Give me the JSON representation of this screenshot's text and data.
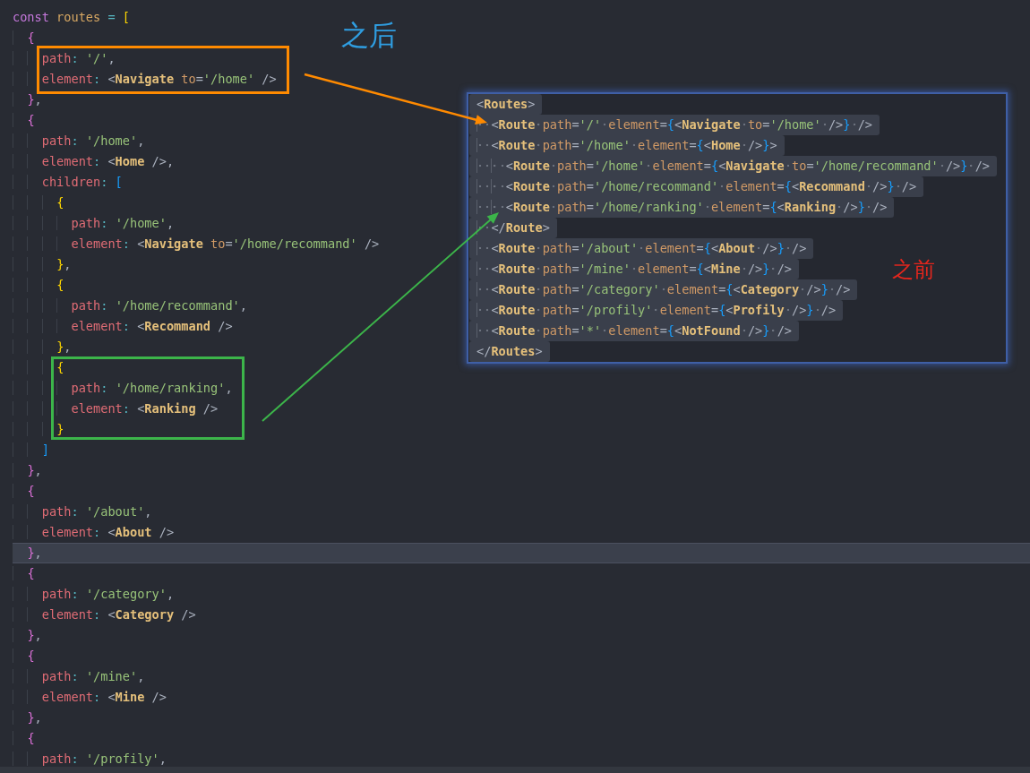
{
  "editor": {
    "lines": [
      {
        "current": false,
        "tokens": [
          {
            "text": "const ",
            "kind": "keyword"
          },
          {
            "text": "routes ",
            "kind": "variable"
          },
          {
            "text": "= ",
            "kind": "operator"
          },
          {
            "text": "[",
            "kind": "bracket1"
          }
        ]
      },
      {
        "current": false,
        "tokens": [
          {
            "text": "  {",
            "kind": "bracket2"
          }
        ]
      },
      {
        "current": false,
        "tokens": [
          {
            "text": "    path",
            "kind": "key"
          },
          {
            "text": ": ",
            "kind": "colon"
          },
          {
            "text": "'/'",
            "kind": "string"
          },
          {
            "text": ",",
            "kind": "punct"
          }
        ]
      },
      {
        "current": false,
        "tokens": [
          {
            "text": "    element",
            "kind": "key"
          },
          {
            "text": ": ",
            "kind": "colon"
          },
          {
            "text": "<",
            "kind": "punct"
          },
          {
            "text": "Navigate ",
            "kind": "tag"
          },
          {
            "text": "to",
            "kind": "attr"
          },
          {
            "text": "=",
            "kind": "punct"
          },
          {
            "text": "'/home' ",
            "kind": "string"
          },
          {
            "text": "/>",
            "kind": "punct"
          }
        ]
      },
      {
        "current": false,
        "tokens": [
          {
            "text": "  }",
            "kind": "bracket2"
          },
          {
            "text": ",",
            "kind": "punct"
          }
        ]
      },
      {
        "current": false,
        "tokens": [
          {
            "text": "  {",
            "kind": "bracket2"
          }
        ]
      },
      {
        "current": false,
        "tokens": [
          {
            "text": "    path",
            "kind": "key"
          },
          {
            "text": ": ",
            "kind": "colon"
          },
          {
            "text": "'/home'",
            "kind": "string"
          },
          {
            "text": ",",
            "kind": "punct"
          }
        ]
      },
      {
        "current": false,
        "tokens": [
          {
            "text": "    element",
            "kind": "key"
          },
          {
            "text": ": ",
            "kind": "colon"
          },
          {
            "text": "<",
            "kind": "punct"
          },
          {
            "text": "Home ",
            "kind": "tag"
          },
          {
            "text": "/>,",
            "kind": "punct"
          }
        ]
      },
      {
        "current": false,
        "tokens": [
          {
            "text": "    children",
            "kind": "key"
          },
          {
            "text": ": ",
            "kind": "colon"
          },
          {
            "text": "[",
            "kind": "bracket3"
          }
        ]
      },
      {
        "current": false,
        "tokens": [
          {
            "text": "      {",
            "kind": "bracket1"
          }
        ]
      },
      {
        "current": false,
        "tokens": [
          {
            "text": "        path",
            "kind": "key"
          },
          {
            "text": ": ",
            "kind": "colon"
          },
          {
            "text": "'/home'",
            "kind": "string"
          },
          {
            "text": ",",
            "kind": "punct"
          }
        ]
      },
      {
        "current": false,
        "tokens": [
          {
            "text": "        element",
            "kind": "key"
          },
          {
            "text": ": ",
            "kind": "colon"
          },
          {
            "text": "<",
            "kind": "punct"
          },
          {
            "text": "Navigate ",
            "kind": "tag"
          },
          {
            "text": "to",
            "kind": "attr"
          },
          {
            "text": "=",
            "kind": "punct"
          },
          {
            "text": "'/home/recommand' ",
            "kind": "string"
          },
          {
            "text": "/>",
            "kind": "punct"
          }
        ]
      },
      {
        "current": false,
        "tokens": [
          {
            "text": "      }",
            "kind": "bracket1"
          },
          {
            "text": ",",
            "kind": "punct"
          }
        ]
      },
      {
        "current": false,
        "tokens": [
          {
            "text": "      {",
            "kind": "bracket1"
          }
        ]
      },
      {
        "current": false,
        "tokens": [
          {
            "text": "        path",
            "kind": "key"
          },
          {
            "text": ": ",
            "kind": "colon"
          },
          {
            "text": "'/home/recommand'",
            "kind": "string"
          },
          {
            "text": ",",
            "kind": "punct"
          }
        ]
      },
      {
        "current": false,
        "tokens": [
          {
            "text": "        element",
            "kind": "key"
          },
          {
            "text": ": ",
            "kind": "colon"
          },
          {
            "text": "<",
            "kind": "punct"
          },
          {
            "text": "Recommand ",
            "kind": "tag"
          },
          {
            "text": "/>",
            "kind": "punct"
          }
        ]
      },
      {
        "current": false,
        "tokens": [
          {
            "text": "      }",
            "kind": "bracket1"
          },
          {
            "text": ",",
            "kind": "punct"
          }
        ]
      },
      {
        "current": false,
        "tokens": [
          {
            "text": "      {",
            "kind": "bracket1"
          }
        ]
      },
      {
        "current": false,
        "tokens": [
          {
            "text": "        path",
            "kind": "key"
          },
          {
            "text": ": ",
            "kind": "colon"
          },
          {
            "text": "'/home/ranking'",
            "kind": "string"
          },
          {
            "text": ",",
            "kind": "punct"
          }
        ]
      },
      {
        "current": false,
        "tokens": [
          {
            "text": "        element",
            "kind": "key"
          },
          {
            "text": ": ",
            "kind": "colon"
          },
          {
            "text": "<",
            "kind": "punct"
          },
          {
            "text": "Ranking ",
            "kind": "tag"
          },
          {
            "text": "/>",
            "kind": "punct"
          }
        ]
      },
      {
        "current": false,
        "tokens": [
          {
            "text": "      }",
            "kind": "bracket1"
          }
        ]
      },
      {
        "current": false,
        "tokens": [
          {
            "text": "    ]",
            "kind": "bracket3"
          }
        ]
      },
      {
        "current": false,
        "tokens": [
          {
            "text": "  }",
            "kind": "bracket2"
          },
          {
            "text": ",",
            "kind": "punct"
          }
        ]
      },
      {
        "current": false,
        "tokens": [
          {
            "text": "  {",
            "kind": "bracket2"
          }
        ]
      },
      {
        "current": false,
        "tokens": [
          {
            "text": "    path",
            "kind": "key"
          },
          {
            "text": ": ",
            "kind": "colon"
          },
          {
            "text": "'/about'",
            "kind": "string"
          },
          {
            "text": ",",
            "kind": "punct"
          }
        ]
      },
      {
        "current": false,
        "tokens": [
          {
            "text": "    element",
            "kind": "key"
          },
          {
            "text": ": ",
            "kind": "colon"
          },
          {
            "text": "<",
            "kind": "punct"
          },
          {
            "text": "About ",
            "kind": "tag"
          },
          {
            "text": "/>",
            "kind": "punct"
          }
        ]
      },
      {
        "current": true,
        "tokens": [
          {
            "text": "  }",
            "kind": "bracket2"
          },
          {
            "text": ",",
            "kind": "punct"
          }
        ]
      },
      {
        "current": false,
        "tokens": [
          {
            "text": "  {",
            "kind": "bracket2"
          }
        ]
      },
      {
        "current": false,
        "tokens": [
          {
            "text": "    path",
            "kind": "key"
          },
          {
            "text": ": ",
            "kind": "colon"
          },
          {
            "text": "'/category'",
            "kind": "string"
          },
          {
            "text": ",",
            "kind": "punct"
          }
        ]
      },
      {
        "current": false,
        "tokens": [
          {
            "text": "    element",
            "kind": "key"
          },
          {
            "text": ": ",
            "kind": "colon"
          },
          {
            "text": "<",
            "kind": "punct"
          },
          {
            "text": "Category ",
            "kind": "tag"
          },
          {
            "text": "/>",
            "kind": "punct"
          }
        ]
      },
      {
        "current": false,
        "tokens": [
          {
            "text": "  }",
            "kind": "bracket2"
          },
          {
            "text": ",",
            "kind": "punct"
          }
        ]
      },
      {
        "current": false,
        "tokens": [
          {
            "text": "  {",
            "kind": "bracket2"
          }
        ]
      },
      {
        "current": false,
        "tokens": [
          {
            "text": "    path",
            "kind": "key"
          },
          {
            "text": ": ",
            "kind": "colon"
          },
          {
            "text": "'/mine'",
            "kind": "string"
          },
          {
            "text": ",",
            "kind": "punct"
          }
        ]
      },
      {
        "current": false,
        "tokens": [
          {
            "text": "    element",
            "kind": "key"
          },
          {
            "text": ": ",
            "kind": "colon"
          },
          {
            "text": "<",
            "kind": "punct"
          },
          {
            "text": "Mine ",
            "kind": "tag"
          },
          {
            "text": "/>",
            "kind": "punct"
          }
        ]
      },
      {
        "current": false,
        "tokens": [
          {
            "text": "  }",
            "kind": "bracket2"
          },
          {
            "text": ",",
            "kind": "punct"
          }
        ]
      },
      {
        "current": false,
        "tokens": [
          {
            "text": "  {",
            "kind": "bracket2"
          }
        ]
      },
      {
        "current": false,
        "tokens": [
          {
            "text": "    path",
            "kind": "key"
          },
          {
            "text": ": ",
            "kind": "colon"
          },
          {
            "text": "'/profily'",
            "kind": "string"
          },
          {
            "text": ",",
            "kind": "punct"
          }
        ]
      }
    ]
  },
  "snippet": {
    "lines": [
      {
        "tokens": [
          {
            "text": "<",
            "kind": "punct"
          },
          {
            "text": "Routes",
            "kind": "tag"
          },
          {
            "text": ">",
            "kind": "punct"
          }
        ]
      },
      {
        "tokens": [
          {
            "text": "  <",
            "kind": "punct"
          },
          {
            "text": "Route ",
            "kind": "tag"
          },
          {
            "text": "path",
            "kind": "attr"
          },
          {
            "text": "=",
            "kind": "punct"
          },
          {
            "text": "'/' ",
            "kind": "string"
          },
          {
            "text": "element",
            "kind": "attr"
          },
          {
            "text": "=",
            "kind": "punct"
          },
          {
            "text": "{",
            "kind": "brace"
          },
          {
            "text": "<",
            "kind": "punct"
          },
          {
            "text": "Navigate ",
            "kind": "tag"
          },
          {
            "text": "to",
            "kind": "attr"
          },
          {
            "text": "=",
            "kind": "punct"
          },
          {
            "text": "'/home' ",
            "kind": "string"
          },
          {
            "text": "/>",
            "kind": "punct"
          },
          {
            "text": "} ",
            "kind": "brace"
          },
          {
            "text": "/>",
            "kind": "punct"
          }
        ]
      },
      {
        "tokens": [
          {
            "text": "  <",
            "kind": "punct"
          },
          {
            "text": "Route ",
            "kind": "tag"
          },
          {
            "text": "path",
            "kind": "attr"
          },
          {
            "text": "=",
            "kind": "punct"
          },
          {
            "text": "'/home' ",
            "kind": "string"
          },
          {
            "text": "element",
            "kind": "attr"
          },
          {
            "text": "=",
            "kind": "punct"
          },
          {
            "text": "{",
            "kind": "brace"
          },
          {
            "text": "<",
            "kind": "punct"
          },
          {
            "text": "Home ",
            "kind": "tag"
          },
          {
            "text": "/>",
            "kind": "punct"
          },
          {
            "text": "}",
            "kind": "brace"
          },
          {
            "text": ">",
            "kind": "punct"
          }
        ]
      },
      {
        "tokens": [
          {
            "text": "    <",
            "kind": "punct"
          },
          {
            "text": "Route ",
            "kind": "tag"
          },
          {
            "text": "path",
            "kind": "attr"
          },
          {
            "text": "=",
            "kind": "punct"
          },
          {
            "text": "'/home' ",
            "kind": "string"
          },
          {
            "text": "element",
            "kind": "attr"
          },
          {
            "text": "=",
            "kind": "punct"
          },
          {
            "text": "{",
            "kind": "brace"
          },
          {
            "text": "<",
            "kind": "punct"
          },
          {
            "text": "Navigate ",
            "kind": "tag"
          },
          {
            "text": "to",
            "kind": "attr"
          },
          {
            "text": "=",
            "kind": "punct"
          },
          {
            "text": "'/home/recommand' ",
            "kind": "string"
          },
          {
            "text": "/>",
            "kind": "punct"
          },
          {
            "text": "} ",
            "kind": "brace"
          },
          {
            "text": "/>",
            "kind": "punct"
          }
        ]
      },
      {
        "tokens": [
          {
            "text": "    <",
            "kind": "punct"
          },
          {
            "text": "Route ",
            "kind": "tag"
          },
          {
            "text": "path",
            "kind": "attr"
          },
          {
            "text": "=",
            "kind": "punct"
          },
          {
            "text": "'/home/recommand' ",
            "kind": "string"
          },
          {
            "text": "element",
            "kind": "attr"
          },
          {
            "text": "=",
            "kind": "punct"
          },
          {
            "text": "{",
            "kind": "brace"
          },
          {
            "text": "<",
            "kind": "punct"
          },
          {
            "text": "Recommand ",
            "kind": "tag"
          },
          {
            "text": "/>",
            "kind": "punct"
          },
          {
            "text": "} ",
            "kind": "brace"
          },
          {
            "text": "/>",
            "kind": "punct"
          }
        ]
      },
      {
        "tokens": [
          {
            "text": "    <",
            "kind": "punct"
          },
          {
            "text": "Route ",
            "kind": "tag"
          },
          {
            "text": "path",
            "kind": "attr"
          },
          {
            "text": "=",
            "kind": "punct"
          },
          {
            "text": "'/home/ranking' ",
            "kind": "string"
          },
          {
            "text": "element",
            "kind": "attr"
          },
          {
            "text": "=",
            "kind": "punct"
          },
          {
            "text": "{",
            "kind": "brace"
          },
          {
            "text": "<",
            "kind": "punct"
          },
          {
            "text": "Ranking ",
            "kind": "tag"
          },
          {
            "text": "/>",
            "kind": "punct"
          },
          {
            "text": "} ",
            "kind": "brace"
          },
          {
            "text": "/>",
            "kind": "punct"
          }
        ]
      },
      {
        "tokens": [
          {
            "text": "  </",
            "kind": "punct"
          },
          {
            "text": "Route",
            "kind": "tag"
          },
          {
            "text": ">",
            "kind": "punct"
          }
        ]
      },
      {
        "tokens": [
          {
            "text": "  <",
            "kind": "punct"
          },
          {
            "text": "Route ",
            "kind": "tag"
          },
          {
            "text": "path",
            "kind": "attr"
          },
          {
            "text": "=",
            "kind": "punct"
          },
          {
            "text": "'/about' ",
            "kind": "string"
          },
          {
            "text": "element",
            "kind": "attr"
          },
          {
            "text": "=",
            "kind": "punct"
          },
          {
            "text": "{",
            "kind": "brace"
          },
          {
            "text": "<",
            "kind": "punct"
          },
          {
            "text": "About ",
            "kind": "tag"
          },
          {
            "text": "/>",
            "kind": "punct"
          },
          {
            "text": "} ",
            "kind": "brace"
          },
          {
            "text": "/>",
            "kind": "punct"
          }
        ]
      },
      {
        "tokens": [
          {
            "text": "  <",
            "kind": "punct"
          },
          {
            "text": "Route ",
            "kind": "tag"
          },
          {
            "text": "path",
            "kind": "attr"
          },
          {
            "text": "=",
            "kind": "punct"
          },
          {
            "text": "'/mine' ",
            "kind": "string"
          },
          {
            "text": "element",
            "kind": "attr"
          },
          {
            "text": "=",
            "kind": "punct"
          },
          {
            "text": "{",
            "kind": "brace"
          },
          {
            "text": "<",
            "kind": "punct"
          },
          {
            "text": "Mine ",
            "kind": "tag"
          },
          {
            "text": "/>",
            "kind": "punct"
          },
          {
            "text": "} ",
            "kind": "brace"
          },
          {
            "text": "/>",
            "kind": "punct"
          }
        ]
      },
      {
        "tokens": [
          {
            "text": "  <",
            "kind": "punct"
          },
          {
            "text": "Route ",
            "kind": "tag"
          },
          {
            "text": "path",
            "kind": "attr"
          },
          {
            "text": "=",
            "kind": "punct"
          },
          {
            "text": "'/category' ",
            "kind": "string"
          },
          {
            "text": "element",
            "kind": "attr"
          },
          {
            "text": "=",
            "kind": "punct"
          },
          {
            "text": "{",
            "kind": "brace"
          },
          {
            "text": "<",
            "kind": "punct"
          },
          {
            "text": "Category ",
            "kind": "tag"
          },
          {
            "text": "/>",
            "kind": "punct"
          },
          {
            "text": "} ",
            "kind": "brace"
          },
          {
            "text": "/>",
            "kind": "punct"
          }
        ]
      },
      {
        "tokens": [
          {
            "text": "  <",
            "kind": "punct"
          },
          {
            "text": "Route ",
            "kind": "tag"
          },
          {
            "text": "path",
            "kind": "attr"
          },
          {
            "text": "=",
            "kind": "punct"
          },
          {
            "text": "'/profily' ",
            "kind": "string"
          },
          {
            "text": "element",
            "kind": "attr"
          },
          {
            "text": "=",
            "kind": "punct"
          },
          {
            "text": "{",
            "kind": "brace"
          },
          {
            "text": "<",
            "kind": "punct"
          },
          {
            "text": "Profily ",
            "kind": "tag"
          },
          {
            "text": "/>",
            "kind": "punct"
          },
          {
            "text": "} ",
            "kind": "brace"
          },
          {
            "text": "/>",
            "kind": "punct"
          }
        ]
      },
      {
        "tokens": [
          {
            "text": "  <",
            "kind": "punct"
          },
          {
            "text": "Route ",
            "kind": "tag"
          },
          {
            "text": "path",
            "kind": "attr"
          },
          {
            "text": "=",
            "kind": "punct"
          },
          {
            "text": "'*' ",
            "kind": "string"
          },
          {
            "text": "element",
            "kind": "attr"
          },
          {
            "text": "=",
            "kind": "punct"
          },
          {
            "text": "{",
            "kind": "brace"
          },
          {
            "text": "<",
            "kind": "punct"
          },
          {
            "text": "NotFound ",
            "kind": "tag"
          },
          {
            "text": "/>",
            "kind": "punct"
          },
          {
            "text": "} ",
            "kind": "brace"
          },
          {
            "text": "/>",
            "kind": "punct"
          }
        ]
      },
      {
        "tokens": [
          {
            "text": "</",
            "kind": "punct"
          },
          {
            "text": "Routes",
            "kind": "tag"
          },
          {
            "text": ">",
            "kind": "punct"
          }
        ]
      }
    ]
  },
  "annotations": {
    "labels": [
      {
        "text": "之后",
        "color": "#2f9de0"
      },
      {
        "text": "之前",
        "color": "#e3261d"
      }
    ],
    "frames": [
      {
        "color": "#ff8a00"
      },
      {
        "color": "#3cb54a"
      }
    ],
    "arrows": [
      {
        "color": "#ff8a00"
      },
      {
        "color": "#3cb54a"
      }
    ]
  }
}
